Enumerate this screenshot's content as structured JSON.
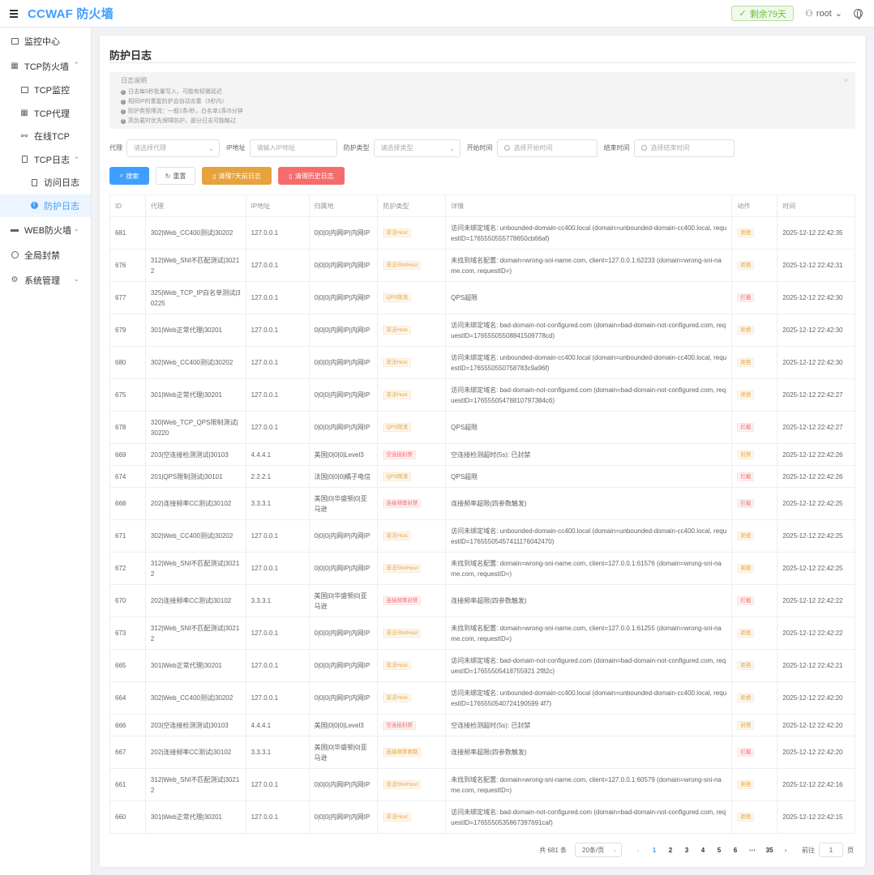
{
  "app": {
    "brand": "CCWAF 防火墙"
  },
  "header": {
    "days_left": "剩余79天",
    "user": "root"
  },
  "sidebar": {
    "items": [
      {
        "label": "监控中心"
      },
      {
        "label": "TCP防火墙"
      },
      {
        "label": "TCP监控"
      },
      {
        "label": "TCP代理"
      },
      {
        "label": "在线TCP"
      },
      {
        "label": "TCP日志"
      },
      {
        "label": "访问日志"
      },
      {
        "label": "防护日志"
      },
      {
        "label": "WEB防火墙"
      },
      {
        "label": "全局封禁"
      },
      {
        "label": "系统管理"
      }
    ]
  },
  "page": {
    "title": "防护日志"
  },
  "notice": {
    "title": "日志说明",
    "lines": [
      "日志每5秒批量写入，可能有轻微延迟",
      "相同IP的重复防护会自动去重（5秒内）",
      "防护类型限流：一般1条/秒，白名单1条/5分钟",
      "高负载时优先保障防护，部分日志可能略过"
    ]
  },
  "filters": {
    "proxy_label": "代理",
    "proxy_placeholder": "请选择代理",
    "ip_label": "IP地址",
    "ip_placeholder": "请输入IP地址",
    "type_label": "防护类型",
    "type_placeholder": "请选择类型",
    "start_label": "开始时间",
    "start_placeholder": "选择开始时间",
    "end_label": "结束时间",
    "end_placeholder": "选择结束时间"
  },
  "buttons": {
    "search": "搜索",
    "reset": "重置",
    "clear7": "清理7天前日志",
    "clear_history": "清理历史日志"
  },
  "table": {
    "headers": [
      "ID",
      "代理",
      "IP地址",
      "归属地",
      "防护类型",
      "详情",
      "动作",
      "时间"
    ],
    "rows": [
      {
        "id": "681",
        "proxy": "302|Web_CC400测试|30202",
        "ip": "127.0.0.1",
        "geo": "0|0|0|内网IP|内网IP",
        "type": "非法Host",
        "type_style": "warn",
        "detail": "访问未绑定域名: unbounded-domain-cc400.local (domain=unbounded-domain-cc400.local, requestID=1765550555778650cb66af)",
        "action": "拒绝",
        "action_style": "warn",
        "time": "2025-12-12 22:42:35"
      },
      {
        "id": "676",
        "proxy": "312|Web_SNI不匹配测试|30212",
        "ip": "127.0.0.1",
        "geo": "0|0|0|内网IP|内网IP",
        "type": "非法SNI/Host",
        "type_style": "warn",
        "detail": "未找到域名配置: domain=wrong-sni-name.com, client=127.0.0.1:62233 (domain=wrong-sni-name.com, requestID=)",
        "action": "拒绝",
        "action_style": "warn",
        "time": "2025-12-12 22:42:31"
      },
      {
        "id": "677",
        "proxy": "325|Web_TCP_IP白名单测试|30225",
        "ip": "127.0.0.1",
        "geo": "0|0|0|内网IP|内网IP",
        "type": "QPS限流",
        "type_style": "warn",
        "detail": "QPS超限",
        "action": "拦截",
        "action_style": "danger",
        "time": "2025-12-12 22:42:30"
      },
      {
        "id": "679",
        "proxy": "301|Web正常代理|30201",
        "ip": "127.0.0.1",
        "geo": "0|0|0|内网IP|内网IP",
        "type": "非法Host",
        "type_style": "warn",
        "detail": "访问未绑定域名: bad-domain-not-configured.com (domain=bad-domain-not-configured.com, requestID=17655505508841509778cd)",
        "action": "拒绝",
        "action_style": "warn",
        "time": "2025-12-12 22:42:30"
      },
      {
        "id": "680",
        "proxy": "302|Web_CC400测试|30202",
        "ip": "127.0.0.1",
        "geo": "0|0|0|内网IP|内网IP",
        "type": "非法Host",
        "type_style": "warn",
        "detail": "访问未绑定域名: unbounded-domain-cc400.local (domain=unbounded-domain-cc400.local, requestID=1765550550758783c9a96f)",
        "action": "拒绝",
        "action_style": "warn",
        "time": "2025-12-12 22:42:30"
      },
      {
        "id": "675",
        "proxy": "301|Web正常代理|30201",
        "ip": "127.0.0.1",
        "geo": "0|0|0|内网IP|内网IP",
        "type": "非法Host",
        "type_style": "warn",
        "detail": "访问未绑定域名: bad-domain-not-configured.com (domain=bad-domain-not-configured.com, requestID=17655505478810797384c6)",
        "action": "拒绝",
        "action_style": "warn",
        "time": "2025-12-12 22:42:27"
      },
      {
        "id": "678",
        "proxy": "320|Web_TCP_QPS限制测试|30220",
        "ip": "127.0.0.1",
        "geo": "0|0|0|内网IP|内网IP",
        "type": "QPS限流",
        "type_style": "warn",
        "detail": "QPS超限",
        "action": "拦截",
        "action_style": "danger",
        "time": "2025-12-12 22:42:27"
      },
      {
        "id": "669",
        "proxy": "203|空连接检测测试|30103",
        "ip": "4.4.4.1",
        "geo": "美国|0|0|0|Level3",
        "type": "空连接封禁",
        "type_style": "danger",
        "detail": "空连接检测超时(5s): 已封禁",
        "action": "封禁",
        "action_style": "warn",
        "time": "2025-12-12 22:42:26"
      },
      {
        "id": "674",
        "proxy": "201|QPS限制测试|30101",
        "ip": "2.2.2.1",
        "geo": "法国|0|0|0|橘子电信",
        "type": "QPS限流",
        "type_style": "warn",
        "detail": "QPS超限",
        "action": "拦截",
        "action_style": "danger",
        "time": "2025-12-12 22:42:26"
      },
      {
        "id": "668",
        "proxy": "202|连接频率CC测试|30102",
        "ip": "3.3.3.1",
        "geo": "美国|0|华盛顿|0|亚马逊",
        "type": "连接频率封禁",
        "type_style": "danger",
        "detail": "连接频率超限(四参数触发)",
        "action": "拦截",
        "action_style": "danger",
        "time": "2025-12-12 22:42:25"
      },
      {
        "id": "671",
        "proxy": "302|Web_CC400测试|30202",
        "ip": "127.0.0.1",
        "geo": "0|0|0|内网IP|内网IP",
        "type": "非法Host",
        "type_style": "warn",
        "detail": "访问未绑定域名: unbounded-domain-cc400.local (domain=unbounded-domain-cc400.local, requestID=17655505457411176042470)",
        "action": "拒绝",
        "action_style": "warn",
        "time": "2025-12-12 22:42:25"
      },
      {
        "id": "672",
        "proxy": "312|Web_SNI不匹配测试|30212",
        "ip": "127.0.0.1",
        "geo": "0|0|0|内网IP|内网IP",
        "type": "非法SNI/Host",
        "type_style": "warn",
        "detail": "未找到域名配置: domain=wrong-sni-name.com, client=127.0.0.1:61576 (domain=wrong-sni-name.com, requestID=)",
        "action": "拒绝",
        "action_style": "warn",
        "time": "2025-12-12 22:42:25"
      },
      {
        "id": "670",
        "proxy": "202|连接频率CC测试|30102",
        "ip": "3.3.3.1",
        "geo": "美国|0|华盛顿|0|亚马逊",
        "type": "连接频率封禁",
        "type_style": "danger",
        "detail": "连接频率超限(四参数触发)",
        "action": "拦截",
        "action_style": "danger",
        "time": "2025-12-12 22:42:22"
      },
      {
        "id": "673",
        "proxy": "312|Web_SNI不匹配测试|30212",
        "ip": "127.0.0.1",
        "geo": "0|0|0|内网IP|内网IP",
        "type": "非法SNI/Host",
        "type_style": "warn",
        "detail": "未找到域名配置: domain=wrong-sni-name.com, client=127.0.0.1:61255 (domain=wrong-sni-name.com, requestID=)",
        "action": "拒绝",
        "action_style": "warn",
        "time": "2025-12-12 22:42:22"
      },
      {
        "id": "665",
        "proxy": "301|Web正常代理|30201",
        "ip": "127.0.0.1",
        "geo": "0|0|0|内网IP|内网IP",
        "type": "非法Host",
        "type_style": "warn",
        "detail": "访问未绑定域名: bad-domain-not-configured.com (domain=bad-domain-not-configured.com, requestID=17655505418755921 2f82c)",
        "action": "拒绝",
        "action_style": "warn",
        "time": "2025-12-12 22:42:21"
      },
      {
        "id": "664",
        "proxy": "302|Web_CC400测试|30202",
        "ip": "127.0.0.1",
        "geo": "0|0|0|内网IP|内网IP",
        "type": "非法Host",
        "type_style": "warn",
        "detail": "访问未绑定域名: unbounded-domain-cc400.local (domain=unbounded-domain-cc400.local, requestID=1765550540724190599 4f7)",
        "action": "拒绝",
        "action_style": "warn",
        "time": "2025-12-12 22:42:20"
      },
      {
        "id": "666",
        "proxy": "203|空连接检测测试|30103",
        "ip": "4.4.4.1",
        "geo": "美国|0|0|0|Level3",
        "type": "空连接封禁",
        "type_style": "danger",
        "detail": "空连接检测超时(5s): 已封禁",
        "action": "封禁",
        "action_style": "warn",
        "time": "2025-12-12 22:42:20"
      },
      {
        "id": "667",
        "proxy": "202|连接频率CC测试|30102",
        "ip": "3.3.3.1",
        "geo": "美国|0|华盛顿|0|亚马逊",
        "type": "连接频率限制",
        "type_style": "warn",
        "detail": "连接频率超限(四参数触发)",
        "action": "拦截",
        "action_style": "danger",
        "time": "2025-12-12 22:42:20"
      },
      {
        "id": "661",
        "proxy": "312|Web_SNI不匹配测试|30212",
        "ip": "127.0.0.1",
        "geo": "0|0|0|内网IP|内网IP",
        "type": "非法SNI/Host",
        "type_style": "warn",
        "detail": "未找到域名配置: domain=wrong-sni-name.com, client=127.0.0.1:60579 (domain=wrong-sni-name.com, requestID=)",
        "action": "拒绝",
        "action_style": "warn",
        "time": "2025-12-12 22:42:16"
      },
      {
        "id": "660",
        "proxy": "301|Web正常代理|30201",
        "ip": "127.0.0.1",
        "geo": "0|0|0|内网IP|内网IP",
        "type": "非法Host",
        "type_style": "warn",
        "detail": "访问未绑定域名: bad-domain-not-configured.com (domain=bad-domain-not-configured.com, requestID=1765550535867397691caf)",
        "action": "拒绝",
        "action_style": "warn",
        "time": "2025-12-12 22:42:15"
      }
    ]
  },
  "pagination": {
    "total": "共 681 条",
    "page_size": "20条/页",
    "pages": [
      "1",
      "2",
      "3",
      "4",
      "5",
      "6",
      "···",
      "35"
    ],
    "current": "1",
    "goto_label": "前往",
    "goto_value": "1",
    "goto_suffix": "页"
  }
}
